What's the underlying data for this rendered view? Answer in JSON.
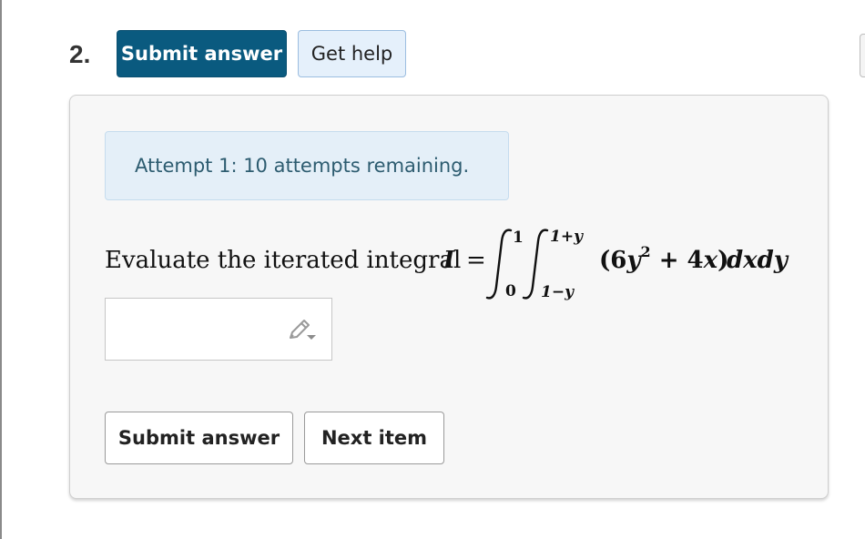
{
  "question": {
    "number": "2.",
    "submit_label": "Submit answer",
    "help_label": "Get help"
  },
  "attempt": {
    "text": "Attempt 1: 10 attempts remaining."
  },
  "prompt": {
    "lead": "Evaluate the iterated integral",
    "variable": "I",
    "equals": "=",
    "outer_upper": "1",
    "outer_lower": "0",
    "inner_upper": "1+y",
    "inner_lower": "1−y",
    "integrand_open": "(6",
    "integrand_y": "y",
    "integrand_exp": "2",
    "integrand_plus": " + 4",
    "integrand_x": "x",
    "integrand_close": ")",
    "differentials": "dxdy"
  },
  "answer": {
    "value": "",
    "placeholder": ""
  },
  "footer": {
    "submit_label": "Submit answer",
    "next_label": "Next item"
  },
  "colors": {
    "primary": "#0a5a7f",
    "help_bg": "#e5f0fb",
    "alert_bg": "#e4eff8",
    "alert_text": "#2d5c70"
  },
  "icons": {
    "answer_tool": "pencil-icon"
  }
}
